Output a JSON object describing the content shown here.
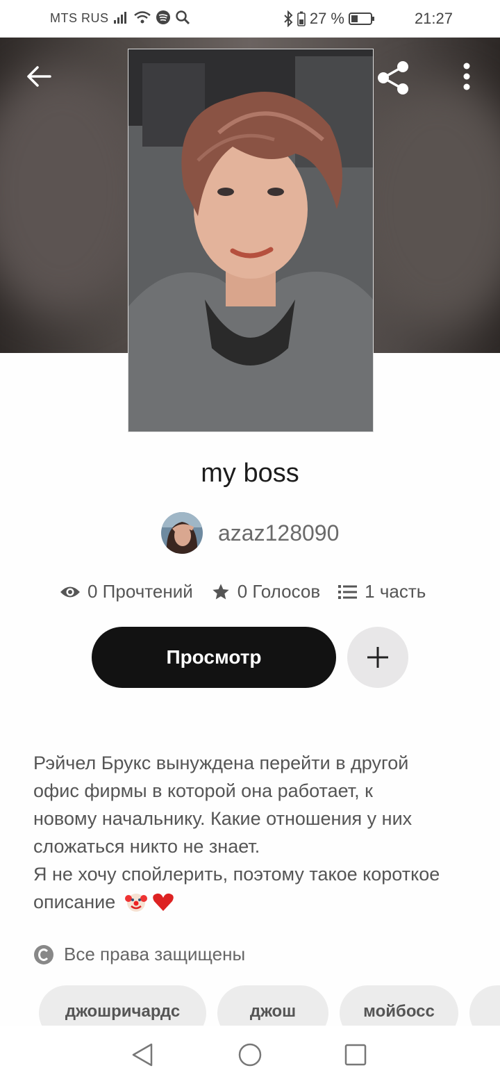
{
  "status_bar": {
    "carrier": "MTS RUS",
    "battery_percent": "27 %",
    "time": "21:27"
  },
  "story": {
    "title": "my boss",
    "author": "azaz128090",
    "reads": "0 Прочтений",
    "votes": "0 Голосов",
    "parts": "1 часть"
  },
  "actions": {
    "read_label": "Просмотр"
  },
  "description": {
    "lines": [
      "Рэйчел Брукс вынуждена перейти в другой",
      "офис фирмы в которой она работает, к",
      "новому начальнику. Какие отношения у них",
      "сложаться никто не знает.",
      "Я не хочу спойлерить, поэтому такое короткое",
      "описание"
    ]
  },
  "rights": {
    "label": "Все права защищены"
  },
  "tags": [
    "джошричардс",
    "джош",
    "мойбосс"
  ],
  "icons": {
    "back": "back-arrow-icon",
    "share": "share-icon",
    "more": "more-vertical-icon",
    "reads": "eye-icon",
    "votes": "star-icon",
    "parts": "list-icon",
    "add": "plus-icon",
    "rights": "copyright-icon"
  }
}
